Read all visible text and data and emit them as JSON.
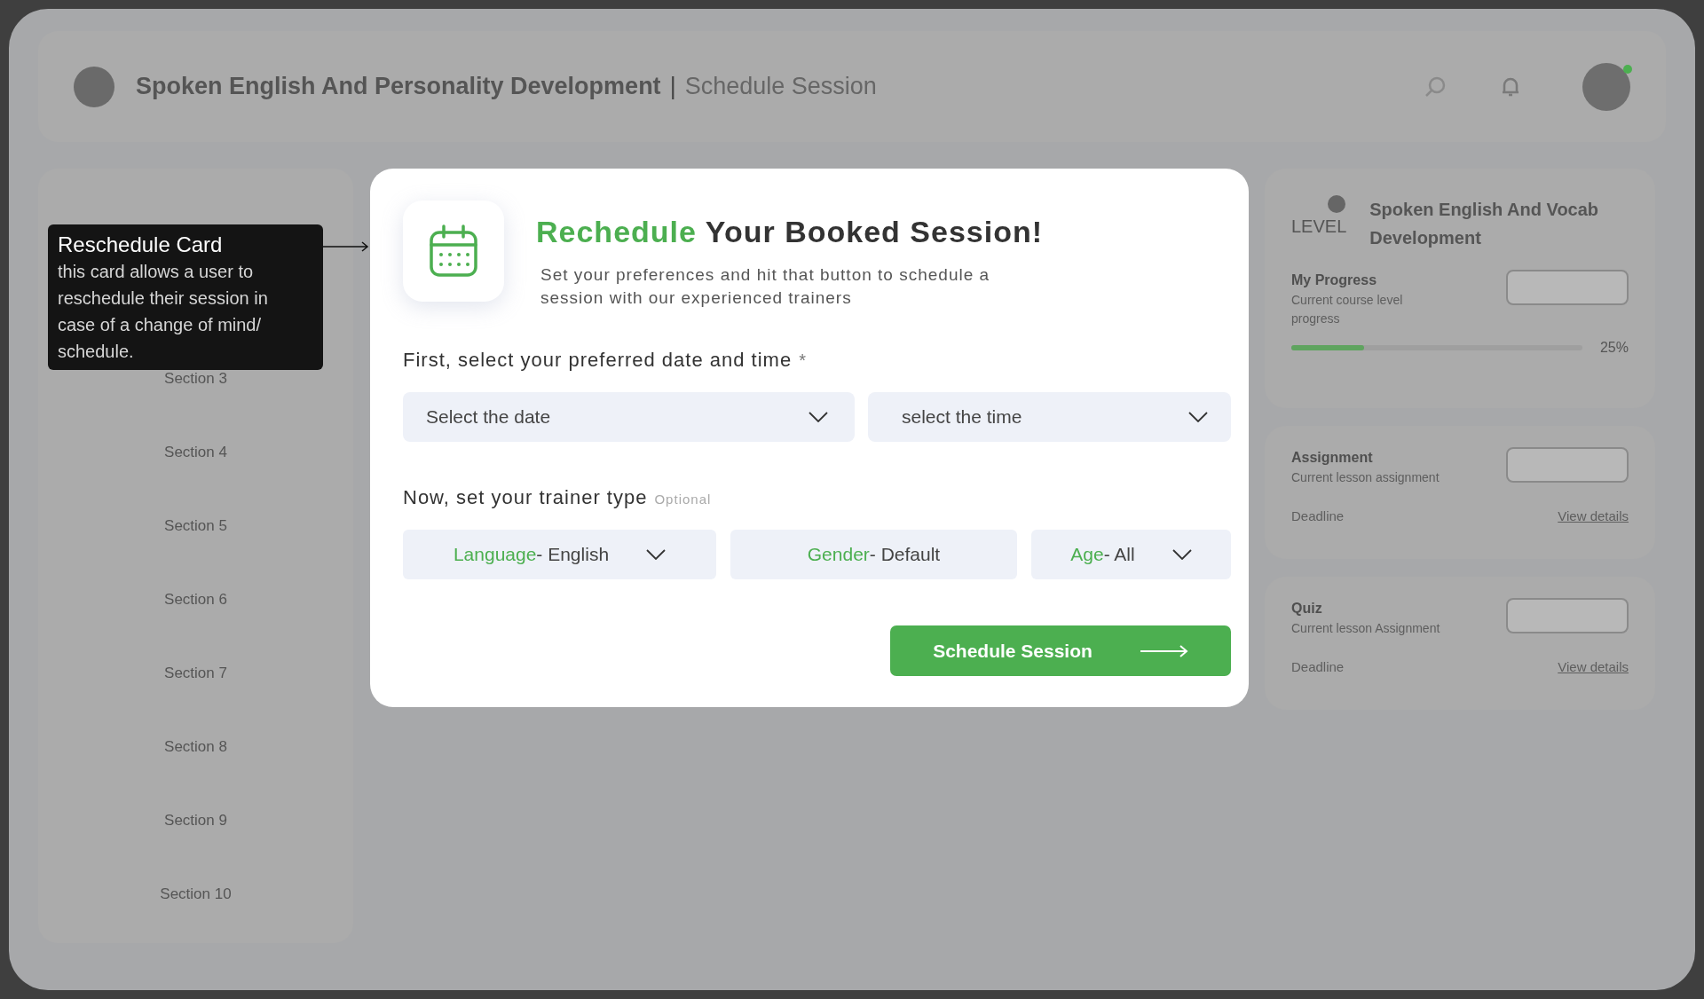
{
  "header": {
    "title": "Spoken English And Personality Development",
    "separator": "|",
    "subtitle": "Schedule Session"
  },
  "sidebar": {
    "items": [
      {
        "label": "Section 3"
      },
      {
        "label": "Section 4"
      },
      {
        "label": "Section 5"
      },
      {
        "label": "Section 6"
      },
      {
        "label": "Section 7"
      },
      {
        "label": "Section 8"
      },
      {
        "label": "Section 9"
      },
      {
        "label": "Section 10"
      }
    ]
  },
  "annotation": {
    "title": "Reschedule Card",
    "body": "this card allows a user to reschedule their session in case of a change of mind/ schedule."
  },
  "modal": {
    "title_highlight": "Rechedule",
    "title_rest": "Your Booked Session!",
    "subtitle": "Set your preferences and hit that button to schedule a session with our experienced trainers",
    "date_label": "First, select your preferred date and time",
    "required_mark": "*",
    "date_fields": [
      {
        "placeholder": "Select the date"
      },
      {
        "placeholder": "select the time"
      }
    ],
    "trainer_label": "Now, set your trainer type",
    "optional_note": "Optional",
    "filters": [
      {
        "label": "Language",
        "value": "- English",
        "kind": "dropdown"
      },
      {
        "label": "Gender",
        "value": "- Default",
        "kind": "plain"
      },
      {
        "label": "Age",
        "value": "- All",
        "kind": "dropdown"
      }
    ],
    "button": "Schedule Session"
  },
  "course_panel": {
    "level_label": "LEVEL",
    "title": "Spoken English And Vocab Development",
    "progress": {
      "title": "My Progress",
      "subtitle": "Current course level progress",
      "level": 0.25,
      "reading": "25%"
    },
    "cards": [
      {
        "title": "Assignment",
        "subtitle": "Current lesson assignment",
        "deadline": "Deadline",
        "link": "View details"
      },
      {
        "title": "Quiz",
        "subtitle": "Current lesson Assignment",
        "deadline": "Deadline",
        "link": "View details"
      }
    ]
  }
}
